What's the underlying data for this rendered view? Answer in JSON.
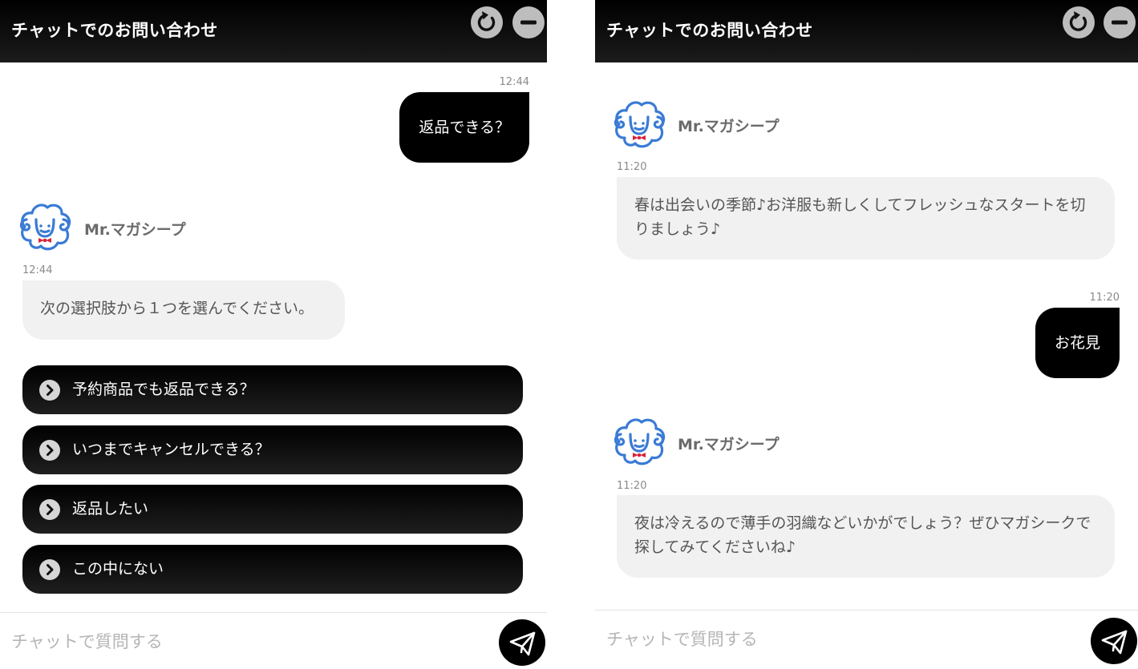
{
  "header": {
    "title": "チャットでのお問い合わせ",
    "reset_icon": "reset-icon",
    "minimize_icon": "minimize-icon"
  },
  "bot": {
    "name": "Mr.マガシープ",
    "avatar_icon": "sheep-avatar-icon"
  },
  "left_chat": {
    "user_message": {
      "time": "12:44",
      "text": "返品できる？"
    },
    "bot_message": {
      "time": "12:44",
      "text": "次の選択肢から１つを選んでください。"
    },
    "options": [
      {
        "label": "予約商品でも返品できる？"
      },
      {
        "label": "いつまでキャンセルできる？"
      },
      {
        "label": "返品したい"
      },
      {
        "label": "この中にない"
      }
    ]
  },
  "right_chat": {
    "bot_message_1": {
      "time": "11:20",
      "text": "春は出会いの季節♪お洋服も新しくしてフレッシュなスタートを切りましょう♪"
    },
    "user_message": {
      "time": "11:20",
      "text": "お花見"
    },
    "bot_message_2": {
      "time": "11:20",
      "text": "夜は冷えるので薄手の羽織などいかがでしょう？ぜひマガシークで探してみてくださいね♪"
    }
  },
  "input": {
    "placeholder": "チャットで質問する",
    "send_icon": "send-icon"
  },
  "colors": {
    "header_bg": "#000000",
    "bot_bubble_bg": "#f1f1f1",
    "user_bubble_bg": "#000000",
    "header_button_bg": "#bdbdbd",
    "avatar_blue": "#3a7bd5",
    "bowtie_red": "#d8243a"
  }
}
